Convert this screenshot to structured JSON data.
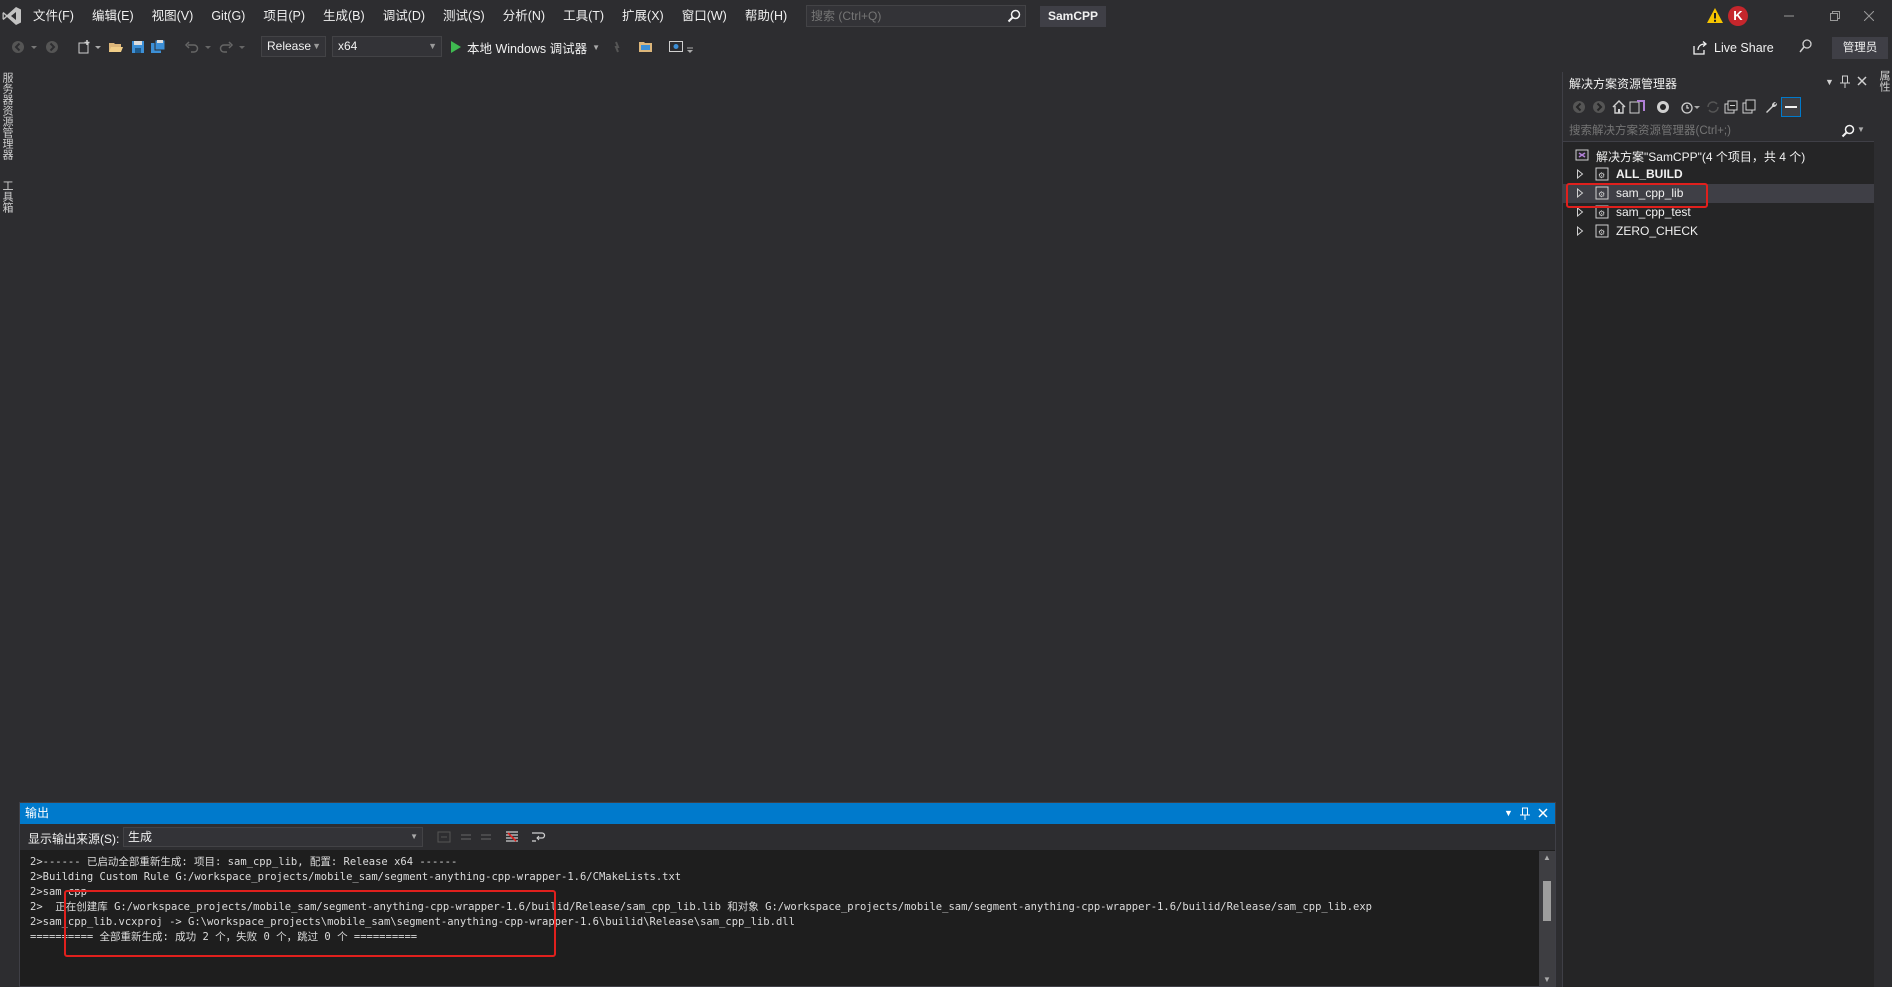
{
  "menu": {
    "items": [
      "文件(F)",
      "编辑(E)",
      "视图(V)",
      "Git(G)",
      "项目(P)",
      "生成(B)",
      "调试(D)",
      "测试(S)",
      "分析(N)",
      "工具(T)",
      "扩展(X)",
      "窗口(W)",
      "帮助(H)"
    ]
  },
  "search": {
    "placeholder": "搜索 (Ctrl+Q)"
  },
  "solution_name": "SamCPP",
  "user_initial": "K",
  "toolbar": {
    "config": "Release",
    "platform": "x64",
    "debugger_label": "本地 Windows 调试器",
    "live_share": "Live Share",
    "admin": "管理员"
  },
  "left_tabs": [
    "服务器资源管理器",
    "工具箱"
  ],
  "right_tabs": [
    "属性"
  ],
  "solution_explorer": {
    "title": "解决方案资源管理器",
    "search_placeholder": "搜索解决方案资源管理器(Ctrl+;)",
    "root": "解决方案\"SamCPP\"(4 个项目，共 4 个)",
    "projects": [
      {
        "label": "ALL_BUILD",
        "bold": true,
        "selected": false
      },
      {
        "label": "sam_cpp_lib",
        "bold": false,
        "selected": true
      },
      {
        "label": "sam_cpp_test",
        "bold": false,
        "selected": false
      },
      {
        "label": "ZERO_CHECK",
        "bold": false,
        "selected": false
      }
    ]
  },
  "output": {
    "title": "输出",
    "source_label": "显示输出来源(S):",
    "source_value": "生成",
    "lines": [
      "2>------ 已启动全部重新生成: 项目: sam_cpp_lib, 配置: Release x64 ------",
      "2>Building Custom Rule G:/workspace_projects/mobile_sam/segment-anything-cpp-wrapper-1.6/CMakeLists.txt",
      "2>sam.cpp",
      "2>  正在创建库 G:/workspace_projects/mobile_sam/segment-anything-cpp-wrapper-1.6/builid/Release/sam_cpp_lib.lib 和对象 G:/workspace_projects/mobile_sam/segment-anything-cpp-wrapper-1.6/builid/Release/sam_cpp_lib.exp",
      "2>sam_cpp_lib.vcxproj -> G:\\workspace_projects\\mobile_sam\\segment-anything-cpp-wrapper-1.6\\builid\\Release\\sam_cpp_lib.dll",
      "========== 全部重新生成: 成功 2 个，失败 0 个，跳过 0 个 =========="
    ]
  },
  "colors": {
    "accent": "#007acc",
    "highlight": "#e0201d",
    "warning": "#f5c400",
    "avatar": "#c5262c"
  }
}
